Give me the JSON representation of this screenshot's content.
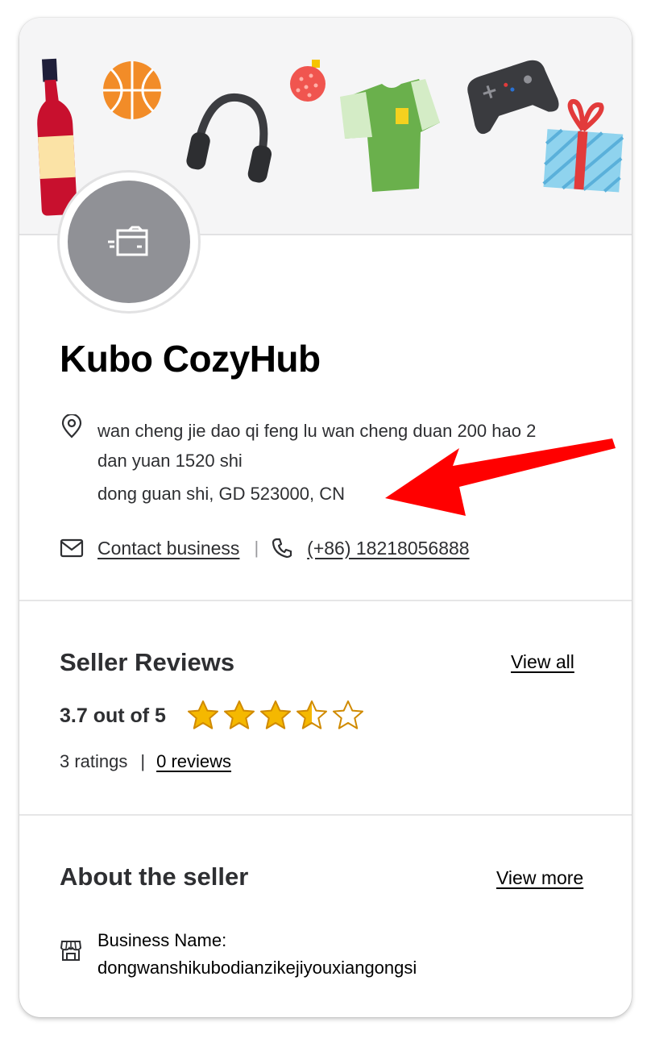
{
  "store": {
    "name": "Kubo CozyHub",
    "address_line1": "wan cheng jie dao qi feng lu wan cheng duan 200 hao 2 dan yuan 1520 shi",
    "address_line2": "dong guan shi, GD 523000, CN",
    "contact_label": "Contact business",
    "phone": "(+86) 18218056888"
  },
  "reviews": {
    "title": "Seller Reviews",
    "view_all": "View all",
    "rating_text": "3.7 out of 5",
    "rating_value": 3.7,
    "rating_max": 5,
    "ratings_count": "3 ratings",
    "separator": "|",
    "reviews_link": "0 reviews"
  },
  "about": {
    "title": "About the seller",
    "view_more": "View more",
    "business_name_label": "Business Name:",
    "business_name": "dongwanshikubodianzikejiyouxiangongsi"
  },
  "icons": {
    "avatar": "delivery-box-icon",
    "address": "location-pin-icon",
    "contact": "envelope-icon",
    "phone": "phone-icon",
    "business": "storefront-icon",
    "banner": [
      "wine-bottle-icon",
      "basketball-icon",
      "headphones-icon",
      "ornament-icon",
      "tshirt-icon",
      "game-controller-icon",
      "gift-box-icon"
    ],
    "annotation": "red-arrow"
  },
  "colors": {
    "star": "#f5b800",
    "star_outline": "#d08a00",
    "avatar_bg": "#909196",
    "arrow": "#ff0000"
  }
}
